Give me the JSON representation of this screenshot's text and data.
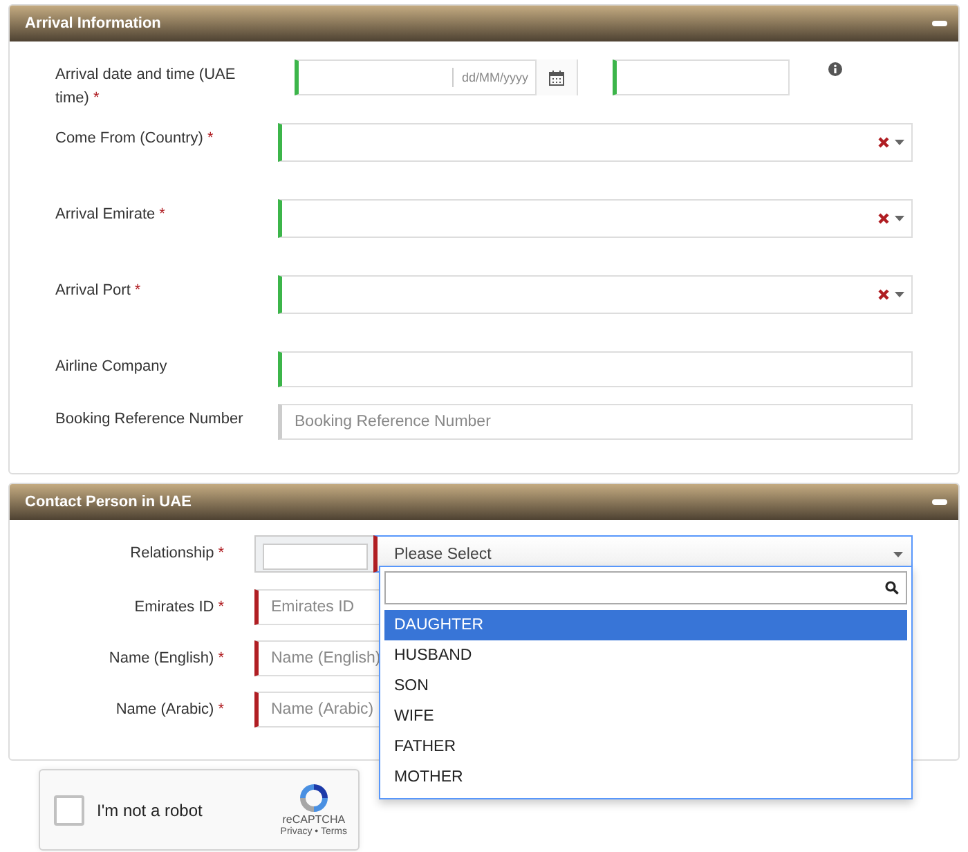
{
  "arrival": {
    "title": "Arrival Information",
    "fields": [
      {
        "kind": "datetime",
        "label": "Arrival date and time (UAE time)",
        "mark": "*",
        "valid": true,
        "date_format": "dd/MM/yyyy",
        "time_valid": true
      },
      {
        "kind": "select",
        "label": "Come From (Country)",
        "mark": "*",
        "valid": true
      },
      {
        "kind": "select",
        "label": "Arrival Emirate",
        "mark": "*",
        "valid": true
      },
      {
        "kind": "select",
        "label": "Arrival Port",
        "mark": "*",
        "valid": true
      },
      {
        "kind": "text",
        "label": "Airline Company",
        "valid": true
      },
      {
        "kind": "text",
        "label": "Booking Reference Number",
        "placeholder": "Booking Reference Number"
      }
    ]
  },
  "contact": {
    "title": "Contact Person in UAE",
    "fields": [
      {
        "kind": "relationship",
        "label": "Relationship",
        "mark": "*",
        "valid": false,
        "placeholder": "Please Select",
        "expanded": true,
        "options": [
          {
            "label": "DAUGHTER",
            "selected": true
          },
          {
            "label": "HUSBAND",
            "selected": false
          },
          {
            "label": "SON",
            "selected": false
          },
          {
            "label": "WIFE",
            "selected": false
          },
          {
            "label": "FATHER",
            "selected": false
          },
          {
            "label": "MOTHER",
            "selected": false
          }
        ]
      },
      {
        "kind": "text",
        "label": "Emirates ID",
        "mark": "*",
        "valid": false,
        "placeholder": "Emirates ID"
      },
      {
        "kind": "text",
        "label": "Name (English)",
        "mark": "*",
        "valid": false,
        "placeholder": "Name (English)"
      },
      {
        "kind": "text",
        "label": "Name (Arabic)",
        "mark": "*",
        "valid": false,
        "placeholder": "Name (Arabic)"
      }
    ]
  },
  "recaptcha": {
    "label": "I'm not a robot",
    "checked": false,
    "brand": "reCAPTCHA",
    "links": "Privacy • Terms"
  }
}
